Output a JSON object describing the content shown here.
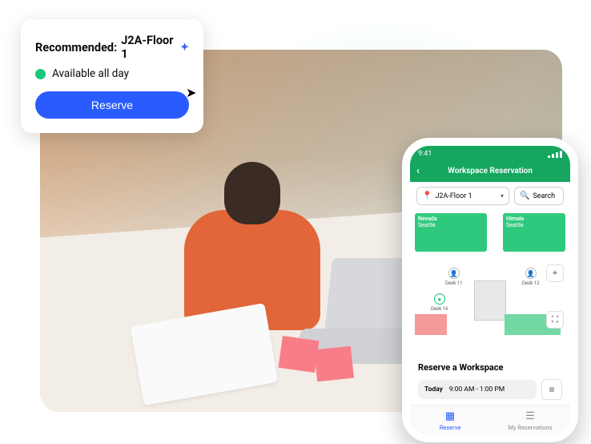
{
  "reco": {
    "title_prefix": "Recommended: ",
    "title_value": "J2A-Floor 1",
    "availability": "Available all day",
    "button": "Reserve"
  },
  "phone": {
    "status": {
      "time": "9:41"
    },
    "header": {
      "title": "Workspace Reservation"
    },
    "toolbar": {
      "location": "J2A-Floor 1",
      "search": "Search"
    },
    "rooms": {
      "left": "Nevada",
      "left_sub": "Seattle",
      "right": "Himala",
      "right_sub": "Seattle"
    },
    "desks": {
      "d1": "Desk 11",
      "d2": "Desk 12",
      "d3": "Desk 16"
    },
    "panel": {
      "title": "Reserve a Workspace",
      "day": "Today",
      "time": "9:00 AM - 1:00 PM"
    },
    "tabs": {
      "reserve": "Reserve",
      "mine": "My Reservations"
    }
  }
}
